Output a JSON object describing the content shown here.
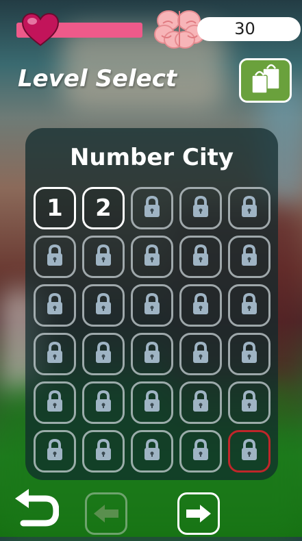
{
  "header": {
    "health_level": 0.55,
    "score": "30",
    "title": "Level Select"
  },
  "panel": {
    "title": "Number City"
  },
  "levels": [
    {
      "label": "1",
      "state": "unlocked"
    },
    {
      "label": "2",
      "state": "unlocked"
    },
    {
      "label": "",
      "state": "locked"
    },
    {
      "label": "",
      "state": "locked"
    },
    {
      "label": "",
      "state": "locked"
    },
    {
      "label": "",
      "state": "locked"
    },
    {
      "label": "",
      "state": "locked"
    },
    {
      "label": "",
      "state": "locked"
    },
    {
      "label": "",
      "state": "locked"
    },
    {
      "label": "",
      "state": "locked"
    },
    {
      "label": "",
      "state": "locked"
    },
    {
      "label": "",
      "state": "locked"
    },
    {
      "label": "",
      "state": "locked"
    },
    {
      "label": "",
      "state": "locked"
    },
    {
      "label": "",
      "state": "locked"
    },
    {
      "label": "",
      "state": "locked"
    },
    {
      "label": "",
      "state": "locked"
    },
    {
      "label": "",
      "state": "locked"
    },
    {
      "label": "",
      "state": "locked"
    },
    {
      "label": "",
      "state": "locked"
    },
    {
      "label": "",
      "state": "locked"
    },
    {
      "label": "",
      "state": "locked"
    },
    {
      "label": "",
      "state": "locked"
    },
    {
      "label": "",
      "state": "locked"
    },
    {
      "label": "",
      "state": "locked"
    },
    {
      "label": "",
      "state": "locked"
    },
    {
      "label": "",
      "state": "locked"
    },
    {
      "label": "",
      "state": "locked"
    },
    {
      "label": "",
      "state": "locked"
    },
    {
      "label": "",
      "state": "locked-highlight"
    }
  ],
  "icons": {
    "heart": "heart-icon",
    "brain": "brain-icon",
    "shop": "shopping-bags-icon",
    "lock": "lock-icon",
    "back": "undo-arrow-icon",
    "prev": "left-arrow-icon",
    "next": "right-arrow-icon"
  },
  "colors": {
    "health": "#ee5a8a",
    "shop_button": "#6aa13c",
    "highlight_tile": "#c0262a",
    "prev_arrow_disabled": "#5a8f4e"
  }
}
